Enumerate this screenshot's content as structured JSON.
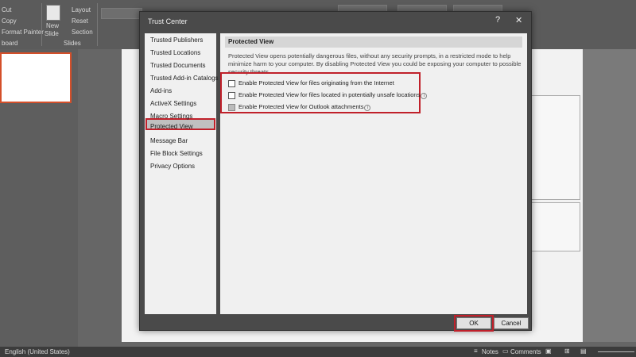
{
  "ribbon": {
    "cut": "Cut",
    "copy": "Copy",
    "format_painter": "Format Painter",
    "clipboard": "board",
    "new_slide": "New",
    "new_slide2": "Slide",
    "layout": "Layout",
    "reset": "Reset",
    "section": "Section",
    "slides_group": "Slides"
  },
  "dialog": {
    "title": "Trust Center",
    "help": "?",
    "close": "✕",
    "nav": [
      "Trusted Publishers",
      "Trusted Locations",
      "Trusted Documents",
      "Trusted Add-in Catalogs",
      "Add-ins",
      "ActiveX Settings",
      "Macro Settings",
      "Protected View",
      "Message Bar",
      "File Block Settings",
      "Privacy Options"
    ],
    "selected_nav": "Protected View",
    "header": "Protected View",
    "description": "Protected View opens potentially dangerous files, without any security prompts, in a restricted mode to help minimize harm to your computer. By disabling Protected View you could be exposing your computer to possible security threats.",
    "options": [
      {
        "label": "Enable Protected View for files originating from the Internet",
        "checked": false,
        "disabled": false,
        "info": false
      },
      {
        "label": "Enable Protected View for files located in potentially unsafe locations",
        "checked": false,
        "disabled": false,
        "info": true
      },
      {
        "label": "Enable Protected View for Outlook attachments",
        "checked": false,
        "disabled": true,
        "info": true
      }
    ],
    "ok_label": "OK",
    "cancel_label": "Cancel"
  },
  "status": {
    "language": "English (United States)",
    "notes": "Notes",
    "comments": "Comments"
  },
  "colors": {
    "highlight": "#c0202a",
    "dialog_bg": "#f0f0f0",
    "dark_bg": "#4a4a4a"
  }
}
